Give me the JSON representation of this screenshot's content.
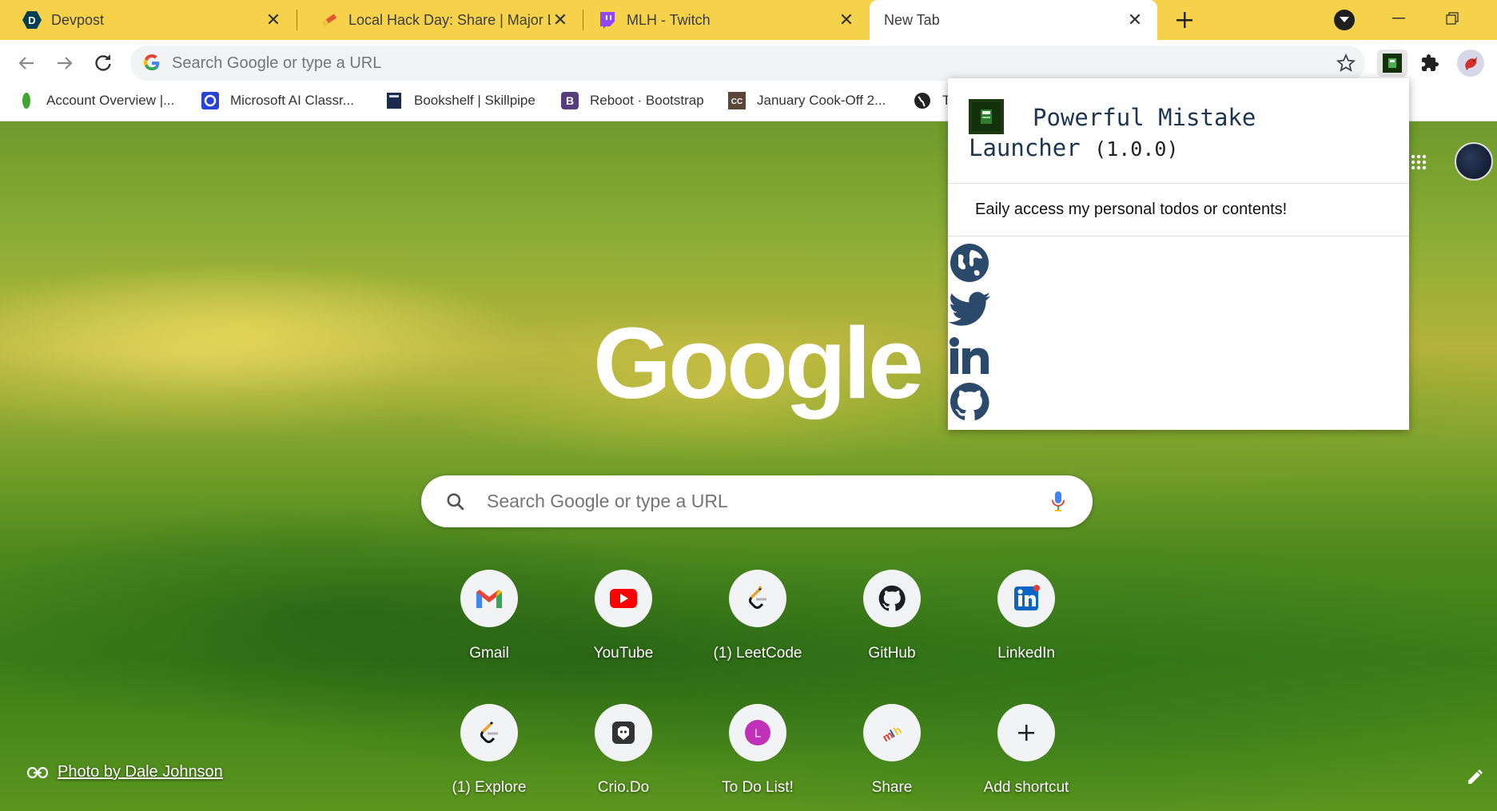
{
  "tabs": [
    {
      "title": "Devpost",
      "favicon": "devpost-icon",
      "active": false
    },
    {
      "title": "Local Hack Day: Share | Major League Hacking",
      "favicon": "mlh-pencil-icon",
      "active": false
    },
    {
      "title": "MLH - Twitch",
      "favicon": "twitch-icon",
      "active": false
    },
    {
      "title": "New Tab",
      "favicon": "",
      "active": true
    }
  ],
  "omnibox": {
    "placeholder": "Search Google or type a URL"
  },
  "bookmarks": [
    {
      "label": "Account Overview |...",
      "icon": "leaf-icon"
    },
    {
      "label": "Microsoft AI Classr...",
      "icon": "microsoft-ai-icon"
    },
    {
      "label": "Bookshelf | Skillpipe",
      "icon": "book-icon"
    },
    {
      "label": "Reboot · Bootstrap",
      "icon": "bootstrap-icon"
    },
    {
      "label": "January Cook-Off 2...",
      "icon": "codechef-icon"
    },
    {
      "label": "T",
      "icon": "globe-icon"
    }
  ],
  "ntp": {
    "logo_text": "Google",
    "search_placeholder": "Search Google or type a URL",
    "shortcuts": [
      {
        "label": "Gmail",
        "icon": "gmail-icon"
      },
      {
        "label": "YouTube",
        "icon": "youtube-icon"
      },
      {
        "label": "(1) LeetCode",
        "icon": "leetcode-icon"
      },
      {
        "label": "GitHub",
        "icon": "github-icon"
      },
      {
        "label": "LinkedIn",
        "icon": "linkedin-icon"
      },
      {
        "label": "(1) Explore",
        "icon": "leetcode-icon"
      },
      {
        "label": "Crio.Do",
        "icon": "crio-icon"
      },
      {
        "label": "To Do List!",
        "icon": "letter-avatar-icon",
        "letter": "L"
      },
      {
        "label": "Share",
        "icon": "mlh-icon"
      },
      {
        "label": "Add shortcut",
        "icon": "plus-icon"
      }
    ],
    "photo_credit": "Photo by Dale Johnson"
  },
  "popup": {
    "title_line1": "Powerful Mistake",
    "title_line2": "Launcher",
    "version": "(1.0.0)",
    "description": "Eaily access my personal todos or contents!",
    "links": [
      "globe-icon",
      "twitter-icon",
      "linkedin-icon",
      "github-icon"
    ]
  },
  "colors": {
    "tabstrip": "#f6d24a",
    "popup_title": "#1e3552",
    "link_icons": "#2b4a6b"
  }
}
